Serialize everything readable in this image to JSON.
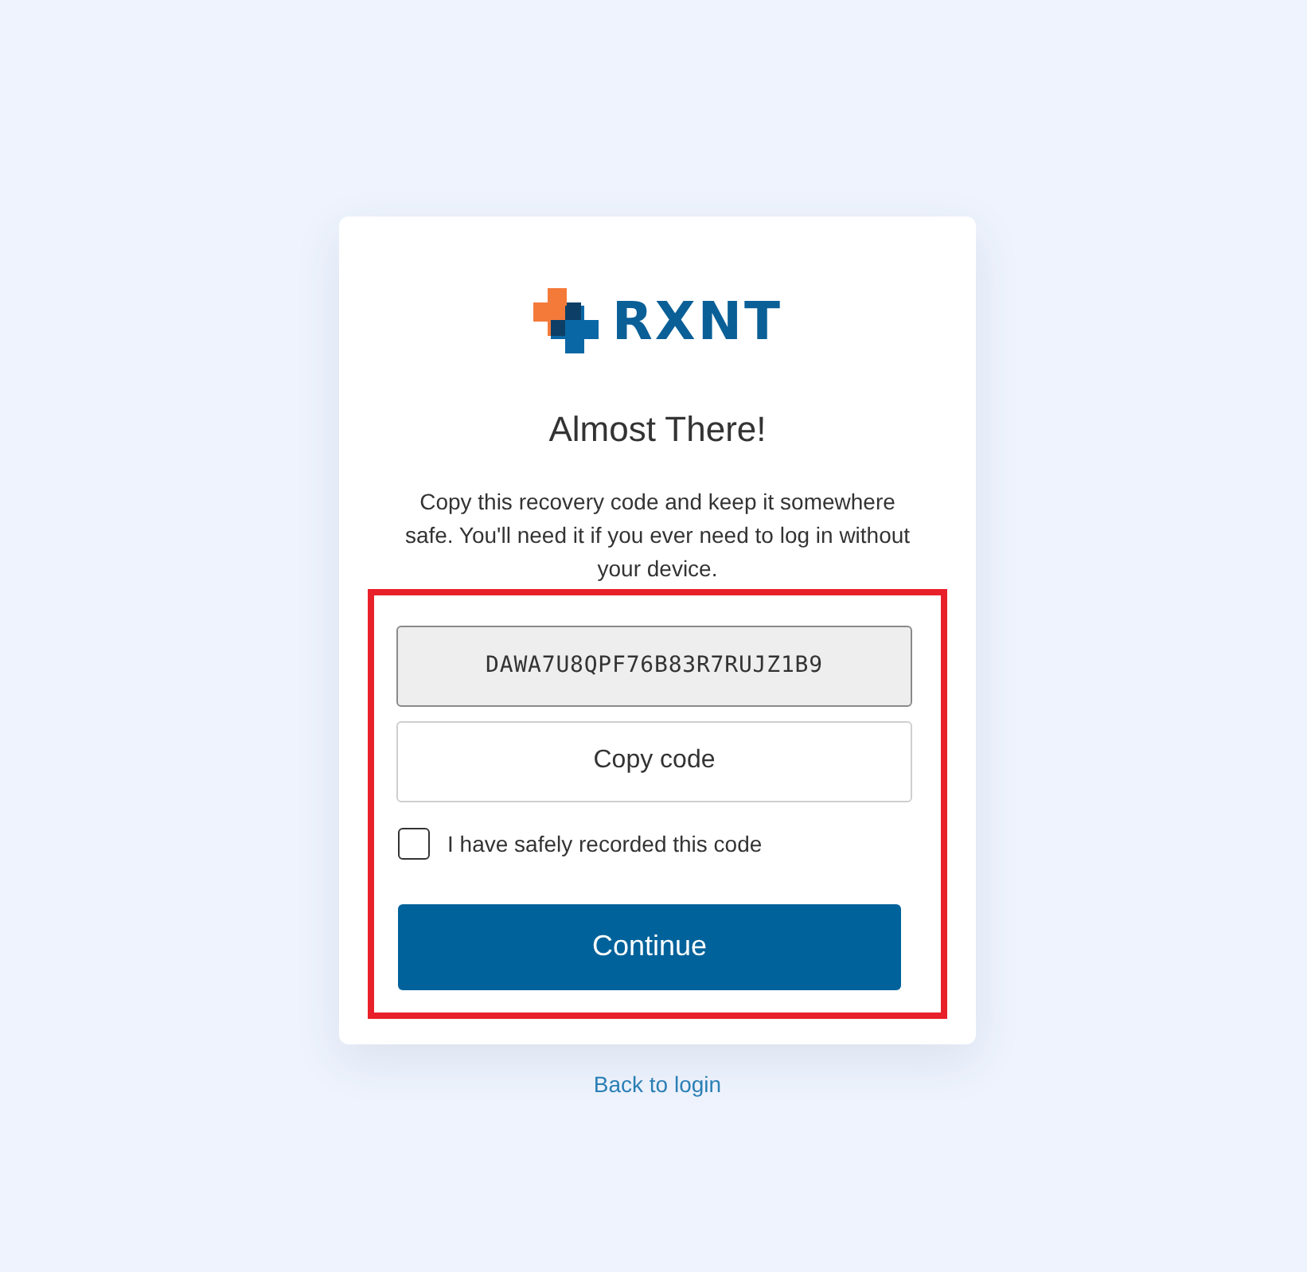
{
  "logo": {
    "text": "RXNT"
  },
  "title": "Almost There!",
  "message": "Copy this recovery code and keep it somewhere safe. You'll need it if you ever need to log in without your device.",
  "recovery": {
    "highlighted": true,
    "code_field": {
      "value": "DAWA7U8QPF76B83R7RUJZ1B9",
      "readonly": true
    },
    "copy_button": {
      "label": "Copy code"
    },
    "confirm": {
      "label": "I have safely recorded this code",
      "checked": false
    },
    "continue_button": {
      "label": "Continue"
    }
  },
  "back_link": {
    "label": "Back to login"
  }
}
